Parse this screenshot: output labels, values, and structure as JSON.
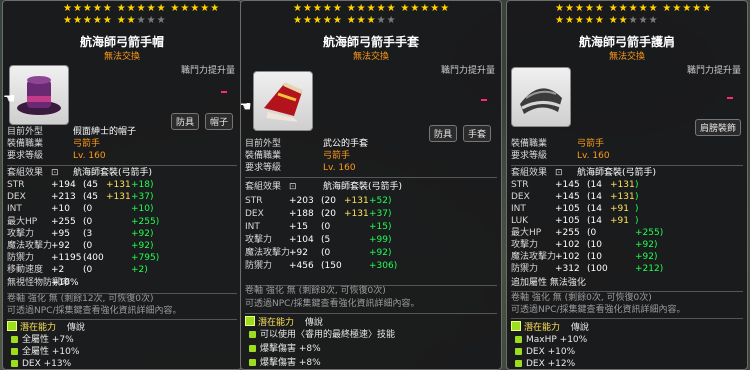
{
  "panels": [
    {
      "stars_filled_row1": 5,
      "stars_filled_row2": 2,
      "title": "航海師弓箭手帽",
      "trade": "無法交換",
      "corner": "職鬥力提升量",
      "tags": [
        "防具",
        "帽子"
      ],
      "info": [
        {
          "label": "目前外型",
          "value": "假面紳士的帽子"
        },
        {
          "label": "裝備職業",
          "value": "弓箭手"
        },
        {
          "label": "要求等級",
          "value": "Lv. 160"
        }
      ],
      "set_label": "套組效果",
      "set_value": "航海師套裝(弓箭手)",
      "stats": [
        {
          "label": "STR",
          "total": "+194",
          "base": "(45",
          "plus1": "+131",
          "plus2": "+18)"
        },
        {
          "label": "DEX",
          "total": "+213",
          "base": "(45",
          "plus1": "+131",
          "plus2": "+37)"
        },
        {
          "label": "INT",
          "total": "+10",
          "base": "(0",
          "plus1": "",
          "plus2": "+10)"
        },
        {
          "label": "最大HP",
          "total": "+255",
          "base": "(0",
          "plus1": "",
          "plus2": "+255)"
        },
        {
          "label": "攻擊力",
          "total": "+95",
          "base": "(3",
          "plus1": "",
          "plus2": "+92)"
        },
        {
          "label": "魔法攻擊力",
          "total": "+92",
          "base": "(0",
          "plus1": "",
          "plus2": "+92)"
        },
        {
          "label": "防禦力",
          "total": "+1195",
          "base": "(400",
          "plus1": "",
          "plus2": "+795)"
        },
        {
          "label": "移動速度",
          "total": "+2",
          "base": "(0",
          "plus1": "",
          "plus2": "+2)"
        },
        {
          "label": "無視怪物防禦率",
          "total": "+10%",
          "base": "",
          "plus1": "",
          "plus2": ""
        }
      ],
      "enhance": "卷軸 強化 無 (剩餘12次, 可恢復0次)",
      "npc_note": "可透過NPC/採集鍵查看強化資訊詳細內容。",
      "potential_title": "潛在能力",
      "potential_grade": "傳說",
      "potential_lines": [
        "全屬性 +7%",
        "全屬性 +10%",
        "DEX +13%"
      ]
    },
    {
      "stars_filled_row1": 5,
      "stars_filled_row2": 3,
      "title": "航海師弓箭手手套",
      "trade": "無法交換",
      "corner": "職鬥力提升量",
      "tags": [
        "防具",
        "手套"
      ],
      "info": [
        {
          "label": "目前外型",
          "value": "武公的手套"
        },
        {
          "label": "裝備職業",
          "value": "弓箭手"
        },
        {
          "label": "要求等級",
          "value": "Lv. 160"
        }
      ],
      "set_label": "套組效果",
      "set_value": "航海師套裝(弓箭手)",
      "stats": [
        {
          "label": "STR",
          "total": "+203",
          "base": "(20",
          "plus1": "+131",
          "plus2": "+52)"
        },
        {
          "label": "DEX",
          "total": "+188",
          "base": "(20",
          "plus1": "+131",
          "plus2": "+37)"
        },
        {
          "label": "INT",
          "total": "+15",
          "base": "(0",
          "plus1": "",
          "plus2": "+15)"
        },
        {
          "label": "攻擊力",
          "total": "+104",
          "base": "(5",
          "plus1": "",
          "plus2": "+99)"
        },
        {
          "label": "魔法攻擊力",
          "total": "+92",
          "base": "(0",
          "plus1": "",
          "plus2": "+92)"
        },
        {
          "label": "防禦力",
          "total": "+456",
          "base": "(150",
          "plus1": "",
          "plus2": "+306)"
        }
      ],
      "enhance": "卷軸 強化 無 (剩餘8次, 可恢復0次)",
      "npc_note": "可透過NPC/採集鍵查看強化資訊詳細內容。",
      "potential_title": "潛在能力",
      "potential_grade": "傳說",
      "potential_lines": [
        "可以使用〈睿用的最終極速〉技能",
        "爆擊傷害 +8%",
        "爆擊傷害 +8%"
      ]
    },
    {
      "stars_filled_row1": 5,
      "stars_filled_row2": 2,
      "title": "航海師弓箭手護肩",
      "trade": "無法交換",
      "corner": "職鬥力提升量",
      "tags": [
        "肩膀裝飾"
      ],
      "info": [
        {
          "label": "裝備職業",
          "value": "弓箭手"
        },
        {
          "label": "要求等級",
          "value": "Lv. 160"
        }
      ],
      "set_label": "套組效果",
      "set_value": "航海師套裝(弓箭手)",
      "stats": [
        {
          "label": "STR",
          "total": "+145",
          "base": "(14",
          "plus1": "+131",
          "plus2": ")"
        },
        {
          "label": "DEX",
          "total": "+145",
          "base": "(14",
          "plus1": "+131",
          "plus2": ")"
        },
        {
          "label": "INT",
          "total": "+105",
          "base": "(14",
          "plus1": "+91",
          "plus2": ")"
        },
        {
          "label": "LUK",
          "total": "+105",
          "base": "(14",
          "plus1": "+91",
          "plus2": ")"
        },
        {
          "label": "最大HP",
          "total": "+255",
          "base": "(0",
          "plus1": "",
          "plus2": "+255)"
        },
        {
          "label": "攻擊力",
          "total": "+102",
          "base": "(10",
          "plus1": "",
          "plus2": "+92)"
        },
        {
          "label": "魔法攻擊力",
          "total": "+102",
          "base": "(10",
          "plus1": "",
          "plus2": "+92)"
        },
        {
          "label": "防禦力",
          "total": "+312",
          "base": "(100",
          "plus1": "",
          "plus2": "+212)"
        }
      ],
      "extra_label": "追加屬性 無法強化",
      "enhance": "卷軸 強化 無 (剩餘0次, 可恢復0次)",
      "npc_note": "可透過NPC/採集鍵查看強化資訊詳細內容。",
      "potential_title": "潛在能力",
      "potential_grade": "傳說",
      "potential_lines": [
        "MaxHP +10%",
        "DEX +10%",
        "DEX +12%"
      ]
    }
  ]
}
